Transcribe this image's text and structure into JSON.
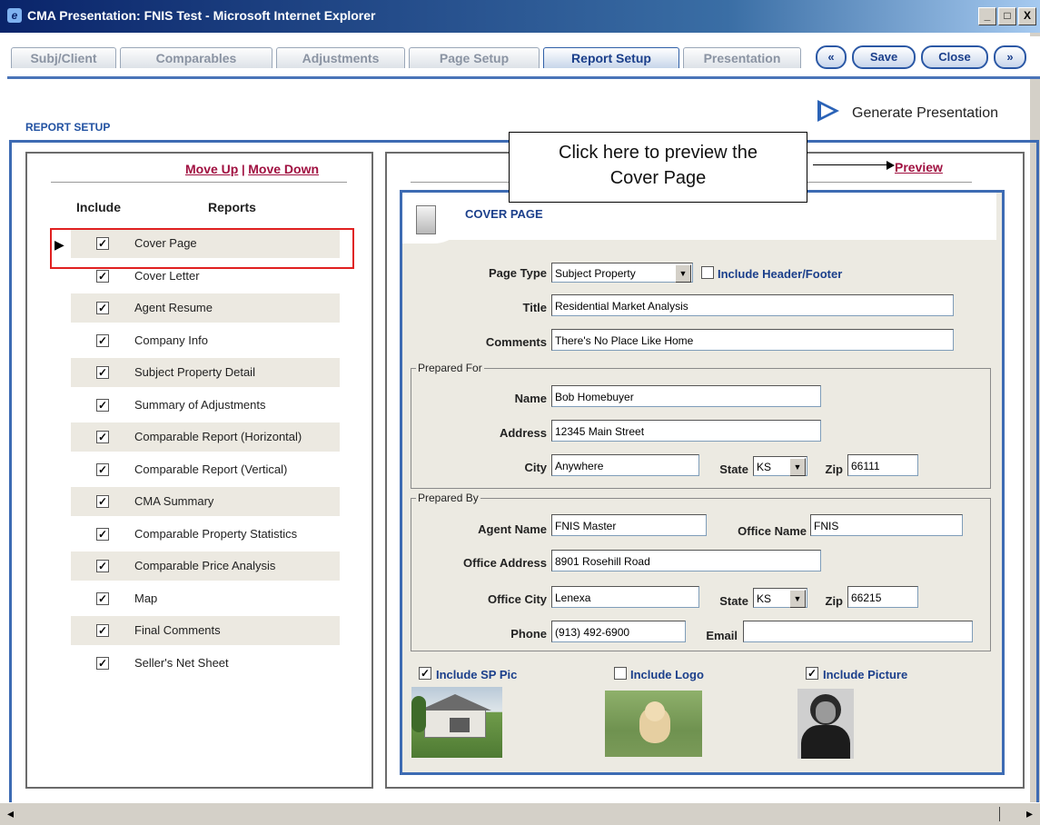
{
  "window": {
    "title": "CMA Presentation: FNIS Test - Microsoft Internet Explorer",
    "controls": [
      "_",
      "□",
      "X"
    ]
  },
  "tabs": [
    {
      "label": "Subj/Client",
      "active": false
    },
    {
      "label": "Comparables",
      "active": false
    },
    {
      "label": "Adjustments",
      "active": false
    },
    {
      "label": "Page Setup",
      "active": false
    },
    {
      "label": "Report Setup",
      "active": true
    },
    {
      "label": "Presentation",
      "active": false
    }
  ],
  "toolbar": {
    "back_label": "«",
    "save_label": "Save",
    "close_label": "Close",
    "forward_label": "»"
  },
  "section_title": "REPORT SETUP",
  "generate_label": "Generate Presentation",
  "reports_panel": {
    "move_up": "Move Up",
    "separator": "|",
    "move_down": "Move Down",
    "col_include": "Include",
    "col_reports": "Reports",
    "current_marker": "▶",
    "items": [
      {
        "label": "Cover Page",
        "checked": true
      },
      {
        "label": "Cover Letter",
        "checked": true
      },
      {
        "label": "Agent Resume",
        "checked": true
      },
      {
        "label": "Company Info",
        "checked": true
      },
      {
        "label": "Subject Property Detail",
        "checked": true
      },
      {
        "label": "Summary of Adjustments",
        "checked": true
      },
      {
        "label": "Comparable Report (Horizontal)",
        "checked": true
      },
      {
        "label": "Comparable Report (Vertical)",
        "checked": true
      },
      {
        "label": "CMA Summary",
        "checked": true
      },
      {
        "label": "Comparable Property Statistics",
        "checked": true
      },
      {
        "label": "Comparable Price Analysis",
        "checked": true
      },
      {
        "label": "Map",
        "checked": true
      },
      {
        "label": "Final Comments",
        "checked": true
      },
      {
        "label": "Seller's Net Sheet",
        "checked": true
      }
    ]
  },
  "callout": {
    "line1": "Click here to preview the",
    "line2": "Cover Page"
  },
  "preview_label": "Preview",
  "cover_page": {
    "heading": "COVER PAGE",
    "page_type_label": "Page Type",
    "page_type_value": "Subject Property",
    "include_header_footer_label": "Include Header/Footer",
    "include_header_footer": false,
    "title_label": "Title",
    "title_value": "Residential Market Analysis",
    "comments_label": "Comments",
    "comments_value": "There's No Place Like Home",
    "prepared_for": {
      "legend": "Prepared For",
      "name_label": "Name",
      "name_value": "Bob Homebuyer",
      "address_label": "Address",
      "address_value": "12345 Main Street",
      "city_label": "City",
      "city_value": "Anywhere",
      "state_label": "State",
      "state_value": "KS",
      "zip_label": "Zip",
      "zip_value": "66111"
    },
    "prepared_by": {
      "legend": "Prepared By",
      "agent_name_label": "Agent Name",
      "agent_name_value": "FNIS Master",
      "office_name_label": "Office Name",
      "office_name_value": "FNIS",
      "office_address_label": "Office Address",
      "office_address_value": "8901 Rosehill Road",
      "office_city_label": "Office City",
      "office_city_value": "Lenexa",
      "state_label": "State",
      "state_value": "KS",
      "zip_label": "Zip",
      "zip_value": "66215",
      "phone_label": "Phone",
      "phone_value": "(913) 492-6900",
      "email_label": "Email",
      "email_value": ""
    },
    "include_sp_pic_label": "Include SP Pic",
    "include_sp_pic": true,
    "include_logo_label": "Include Logo",
    "include_logo": false,
    "include_picture_label": "Include Picture",
    "include_picture": true
  },
  "colors": {
    "accent": "#3d6bb3",
    "link": "#a01040",
    "label_blue": "#1b3f8b",
    "highlight": "#e02020"
  },
  "scroll": {
    "left_arrow": "◂",
    "right_arrow": "▸"
  }
}
